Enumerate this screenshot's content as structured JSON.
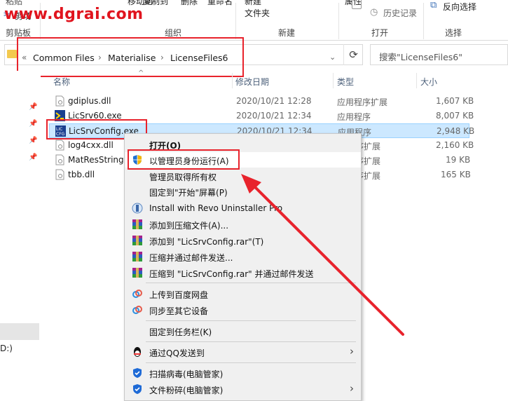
{
  "ribbon": {
    "top_cut_texts": [
      "粘贴",
      "移动到",
      "复制到",
      "删除",
      "重命名",
      "新建",
      "属性",
      "反向选择"
    ],
    "cut_label": "剪切",
    "clipboard_group": "剪贴板",
    "organize_group": "组织",
    "new_group": "新建",
    "open_group": "打开",
    "select_group": "选择",
    "folder_label": "文件夹",
    "history_label": "历史记录",
    "invert_label": "反向选择"
  },
  "watermark": "www.dgrai.com",
  "address": {
    "overflow": "«",
    "crumbs": [
      "Common Files",
      "Materialise",
      "LicenseFiles6"
    ],
    "search_placeholder": "搜索\"LicenseFiles6\""
  },
  "columns": {
    "name": "名称",
    "date": "修改日期",
    "type": "类型",
    "size": "大小"
  },
  "files": [
    {
      "name": "gdiplus.dll",
      "date": "2020/10/21 12:28",
      "type": "应用程序扩展",
      "size": "1,607 KB",
      "icon": "dll-icon"
    },
    {
      "name": "LicSrv60.exe",
      "date": "2020/10/21 12:34",
      "type": "应用程序",
      "size": "8,007 KB",
      "icon": "licsrv-exe-icon"
    },
    {
      "name": "LicSrvConfig.exe",
      "date": "2020/10/21 12:34",
      "type": "应用程序",
      "size": "2,948 KB",
      "icon": "licsrvconfig-exe-icon"
    },
    {
      "name": "log4cxx.dll",
      "date": "",
      "type": "序扩展",
      "size": "2,160 KB",
      "icon": "dll-icon"
    },
    {
      "name": "MatResString.",
      "date": "",
      "type": "序扩展",
      "size": "19 KB",
      "icon": "dll-icon"
    },
    {
      "name": "tbb.dll",
      "date": "",
      "type": "序扩展",
      "size": "165 KB",
      "icon": "dll-icon"
    }
  ],
  "nav": {
    "drive_label": "D:)"
  },
  "context_menu": {
    "open": "打开(O)",
    "run_as_admin": "以管理员身份运行(A)",
    "take_ownership": "管理员取得所有权",
    "pin_start": "固定到\"开始\"屏幕(P)",
    "revo": "Install with Revo Uninstaller Pro",
    "add_archive": "添加到压缩文件(A)...",
    "add_rar": "添加到 \"LicSrvConfig.rar\"(T)",
    "compress_email": "压缩并通过邮件发送...",
    "compress_rar_email": "压缩到 \"LicSrvConfig.rar\" 并通过邮件发送",
    "upload_baidu": "上传到百度网盘",
    "sync_device": "同步至其它设备",
    "pin_taskbar": "固定到任务栏(K)",
    "send_qq": "通过QQ发送到",
    "scan_virus": "扫描病毒(电脑管家)",
    "shred": "文件粉碎(电脑管家)"
  },
  "colors": {
    "highlight_red": "#e8232c",
    "selection_blue": "#cce8ff",
    "menu_bg": "#f0f0f0"
  }
}
